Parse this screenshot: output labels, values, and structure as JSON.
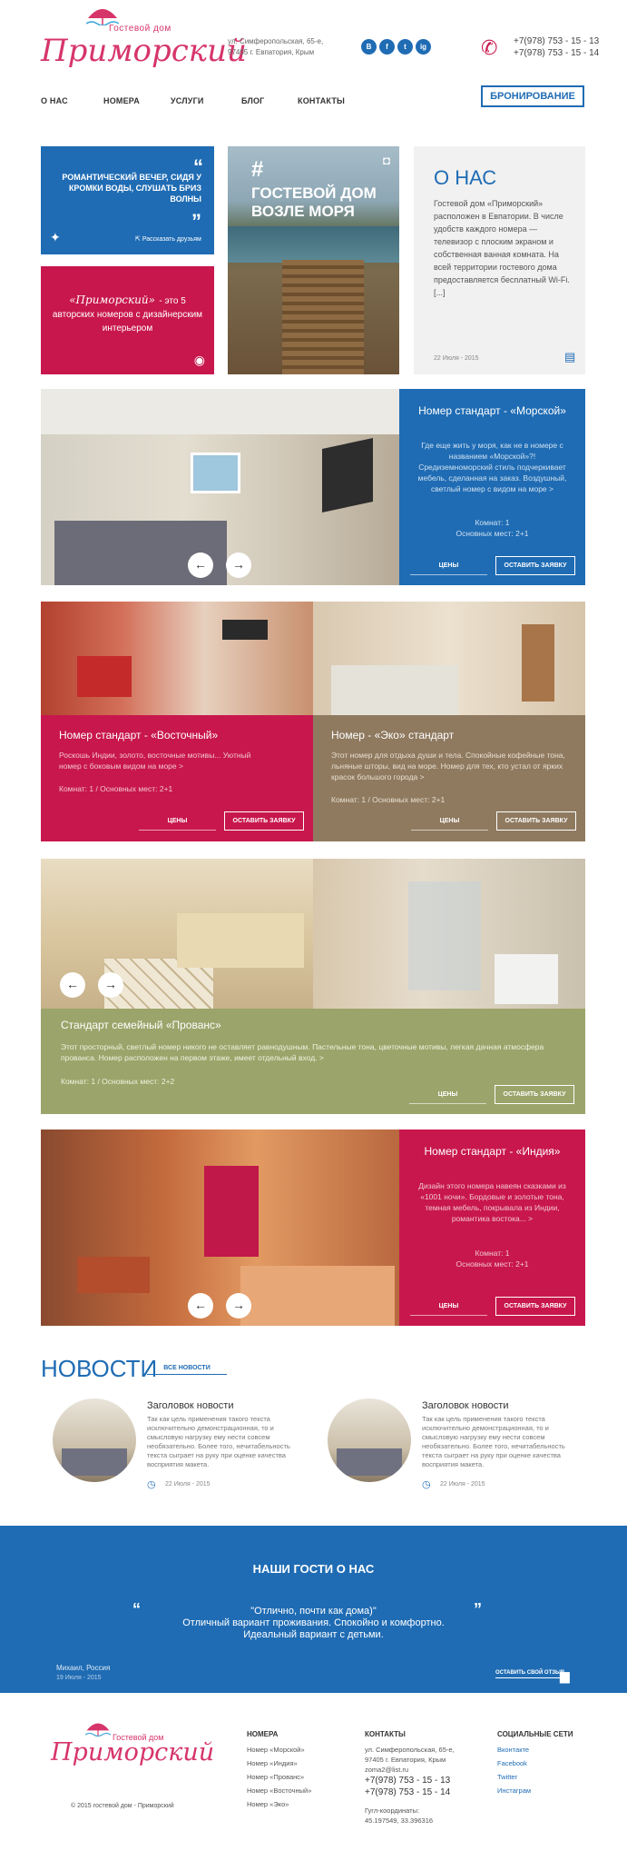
{
  "header": {
    "logo_small": "Гостевой дом",
    "logo_name": "Приморский",
    "address_line1": "ул. Симферопольская, 65-е,",
    "address_line2": "97405 г. Евпатория, Крым",
    "social": [
      {
        "label": "В",
        "icon": "vk-icon"
      },
      {
        "label": "f",
        "icon": "facebook-icon"
      },
      {
        "label": "t",
        "icon": "twitter-icon"
      },
      {
        "label": "ig",
        "icon": "instagram-icon"
      }
    ],
    "phone1": "+7(978) 753 - 15 - 13",
    "phone2": "+7(978) 753 - 15 - 14"
  },
  "nav": {
    "items": [
      "О НАС",
      "НОМЕРА",
      "УСЛУГИ",
      "БЛОГ",
      "КОНТАКТЫ"
    ],
    "booking": "БРОНИРОВАНИЕ"
  },
  "promo": {
    "quote": "РОМАНТИЧЕСКИЙ ВЕЧЕР, СИДЯ У КРОМКИ ВОДЫ, СЛУШАТЬ БРИЗ ВОЛНЫ",
    "share": "Рассказать друзьям",
    "rooms_brand": "«Приморский»",
    "rooms_text": "- это 5 авторских номеров с дизайнерским интерьером",
    "photo_hash": "#",
    "photo_title": "ГОСТЕВОЙ ДОМ ВОЗЛЕ МОРЯ"
  },
  "about": {
    "title": "О НАС",
    "text": "Гостевой дом «Приморский» расположен в Евпатории. В числе удобств каждого номера — телевизор с плоским экраном и собственная ванная комната. На всей территории гостевого дома предоставляется бесплатный Wi-Fi.",
    "more": "[...]",
    "date": "22 Июля - 2015"
  },
  "rooms": [
    {
      "title": "Номер стандарт - «Морской»",
      "desc": "Где еще жить у моря, как не в номере с названием «Морской»?! Средиземноморский стиль подчеркивает мебель, сделанная на заказ. Воздушный, светлый номер с видом на море >",
      "rooms": "Комнат: 1",
      "places": "Основных мест: 2+1",
      "prices": "ЦЕНЫ",
      "order": "ОСТАВИТЬ ЗАЯВКУ"
    },
    {
      "title": "Номер стандарт - «Восточный»",
      "desc": "Роскошь Индии, золото, восточные мотивы... Уютный номер с боковым видом на море >",
      "info": "Комнат: 1 / Основных мест: 2+1",
      "prices": "ЦЕНЫ",
      "order": "ОСТАВИТЬ ЗАЯВКУ"
    },
    {
      "title": "Номер - «Эко» стандарт",
      "desc": "Этот номер для отдыха души и тела. Спокойные кофейные тона, льняные шторы, вид на море. Номер для тех, кто устал от ярких красок большого города >",
      "info": "Комнат: 1 / Основных мест: 2+1",
      "prices": "ЦЕНЫ",
      "order": "ОСТАВИТЬ ЗАЯВКУ"
    },
    {
      "title": "Стандарт семейный «Прованс»",
      "desc": "Этот просторный, светлый номер никого не оставляет равнодушным. Пастельные тона, цветочные мотивы, легкая дачная атмосфера прованса. Номер расположен на первом этаже, имеет отдельный вход. >",
      "info": "Комнат: 1 / Основных мест: 2+2",
      "prices": "ЦЕНЫ",
      "order": "ОСТАВИТЬ ЗАЯВКУ"
    },
    {
      "title": "Номер стандарт - «Индия»",
      "desc": "Дизайн этого номера навеян сказками из «1001 ночи». Бордовые и золотые тона, темная мебель, покрывала из Индии, романтика востока... >",
      "rooms": "Комнат: 1",
      "places": "Основных мест: 2+1",
      "prices": "ЦЕНЫ",
      "order": "ОСТАВИТЬ ЗАЯВКУ"
    }
  ],
  "news": {
    "title": "НОВОСТИ",
    "all": "ВСЕ НОВОСТИ",
    "items": [
      {
        "title": "Заголовок новости",
        "text": "Так как цель применения такого текста исключительно демонстрационная, то и смысловую нагрузку ему нести совсем необязательно. Более того, нечитабельность текста сыграет на руку при оценке качества восприятия макета.",
        "date": "22 Июля - 2015"
      },
      {
        "title": "Заголовок новости",
        "text": "Так как цель применения такого текста исключительно демонстрационная, то и смысловую нагрузку ему нести совсем необязательно. Более того, нечитабельность текста сыграет на руку при оценке качества восприятия макета.",
        "date": "22 Июля - 2015"
      }
    ]
  },
  "guests": {
    "title": "НАШИ ГОСТИ О НАС",
    "quote1": "\"Отлично, почти как дома)\"",
    "quote2": "Отличный вариант проживания. Спокойно и комфортно.",
    "quote3": "Идеальный вариант с детьми.",
    "author": "Михаил, Россия",
    "date": "19 Июля - 2015",
    "leave": "ОСТАВИТЬ СВОЙ ОТЗЫВ"
  },
  "footer": {
    "logo_small": "Гостевой дом",
    "logo_name": "Приморский",
    "copyright": "© 2015 гостевой дом - Приморский",
    "rooms_title": "НОМЕРА",
    "rooms_links": [
      "Номер «Морской»",
      "Номер «Индия»",
      "Номер «Прованс»",
      "Номер «Восточный»",
      "Номер «Эко»"
    ],
    "contacts_title": "КОНТАКТЫ",
    "address1": "ул. Симферопольская, 65-е,",
    "address2": "97405 г. Евпатория, Крым",
    "email": "zoma2@list.ru",
    "phone1": "+7(978) 753 - 15 - 13",
    "phone2": "+7(978) 753 - 15 - 14",
    "gps_label": "Гугл-координаты:",
    "gps": "45.197549, 33.396316",
    "social_title": "СОЦИАЛЬНЫЕ СЕТИ",
    "social_links": [
      "Вконтакте",
      "Facebook",
      "Twitter",
      "Инстаграм"
    ]
  },
  "colors": {
    "blue": "#1f6cb4",
    "crimson": "#c8174d",
    "brown": "#8f7a60",
    "olive": "#9ba46a"
  }
}
